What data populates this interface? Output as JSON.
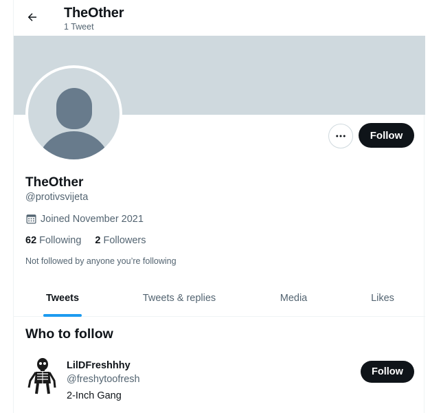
{
  "header": {
    "name": "TheOther",
    "tweet_count": "1 Tweet"
  },
  "profile": {
    "name": "TheOther",
    "handle": "@protivsvijeta",
    "joined": "Joined November 2021",
    "following_count": "62",
    "following_label": "Following",
    "followers_count": "2",
    "followers_label": "Followers",
    "not_followed_note": "Not followed by anyone you’re following",
    "follow_label": "Follow"
  },
  "tabs": [
    {
      "label": "Tweets",
      "active": true
    },
    {
      "label": "Tweets & replies",
      "active": false
    },
    {
      "label": "Media",
      "active": false
    },
    {
      "label": "Likes",
      "active": false
    }
  ],
  "who_to_follow": {
    "title": "Who to follow",
    "users": [
      {
        "name": "LilDFreshhhy",
        "handle": "@freshytoofresh",
        "bio": "2-Inch Gang",
        "follow_label": "Follow"
      }
    ]
  },
  "colors": {
    "banner": "#cfd9de",
    "avatar_placeholder": "#687b8c",
    "tab_indicator": "#1d9bf0",
    "button_dark": "#0f1419",
    "secondary_text": "#536471"
  },
  "icons": [
    "back-arrow-icon",
    "more-icon",
    "calendar-icon",
    "default-avatar-icon"
  ]
}
